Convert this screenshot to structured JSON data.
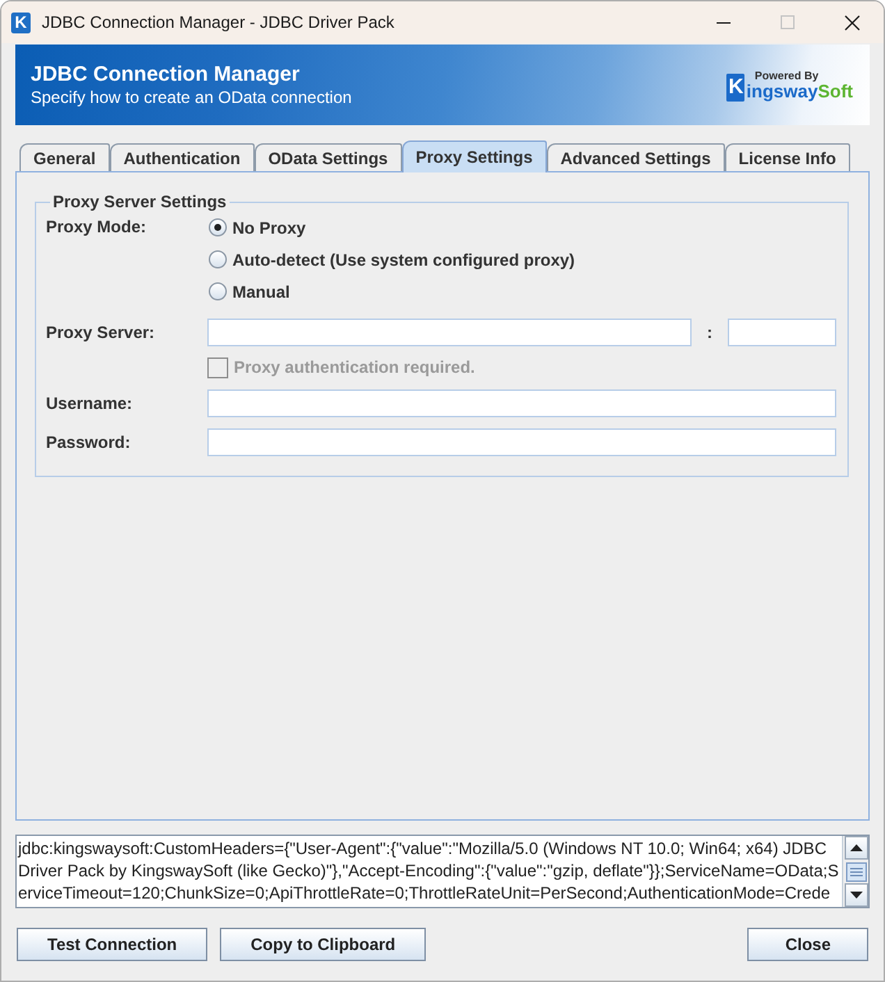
{
  "window": {
    "icon_letter": "K",
    "title": "JDBC Connection Manager - JDBC Driver Pack",
    "controls": [
      {
        "kind": "minimize",
        "disabled": false
      },
      {
        "kind": "maximize",
        "disabled": true
      },
      {
        "kind": "close",
        "disabled": false
      }
    ]
  },
  "header": {
    "title": "JDBC Connection Manager",
    "subtitle": "Specify how to create an OData connection",
    "logo": {
      "tagline": "Powered By",
      "initial": "K",
      "name_start": "ingsway",
      "name_end": "Soft"
    }
  },
  "tabs": [
    {
      "label": "General",
      "selected": false
    },
    {
      "label": "Authentication",
      "selected": false
    },
    {
      "label": "OData Settings",
      "selected": false
    },
    {
      "label": "Proxy Settings",
      "selected": true
    },
    {
      "label": "Advanced Settings",
      "selected": false
    },
    {
      "label": "License Info",
      "selected": false
    }
  ],
  "proxy_settings": {
    "title": "Proxy Server Settings",
    "mode_label": "Proxy Mode:",
    "modes": [
      {
        "label": "No Proxy",
        "selected": true
      },
      {
        "label": "Auto-detect (Use system configured proxy)",
        "selected": false
      },
      {
        "label": "Manual",
        "selected": false
      }
    ],
    "server_label": "Proxy Server:",
    "port_separator": ":",
    "auth": {
      "label": "Proxy authentication required.",
      "checked": false,
      "disabled": true
    },
    "username_label": "Username:",
    "password_label": "Password:"
  },
  "connection_string": {
    "lines": [
      "jdbc:kingswaysoft:CustomHeaders={\"User-Agent\":{\"value\":\"Mozilla/5.0 (Windows NT 10.0; Win64; x64) JDBC",
      "Driver Pack by KingswaySoft (like Gecko)\"},\"Accept-Encoding\":{\"value\":\"gzip, deflate\"}};ServiceName=OData;S",
      "erviceTimeout=120;ChunkSize=0;ApiThrottleRate=0;ThrottleRateUnit=PerSecond;AuthenticationMode=Crede"
    ]
  },
  "buttons_left": [
    {
      "label": "Test Connection"
    },
    {
      "label": "Copy to Clipboard"
    }
  ],
  "buttons_right": [
    {
      "label": "Close"
    }
  ]
}
